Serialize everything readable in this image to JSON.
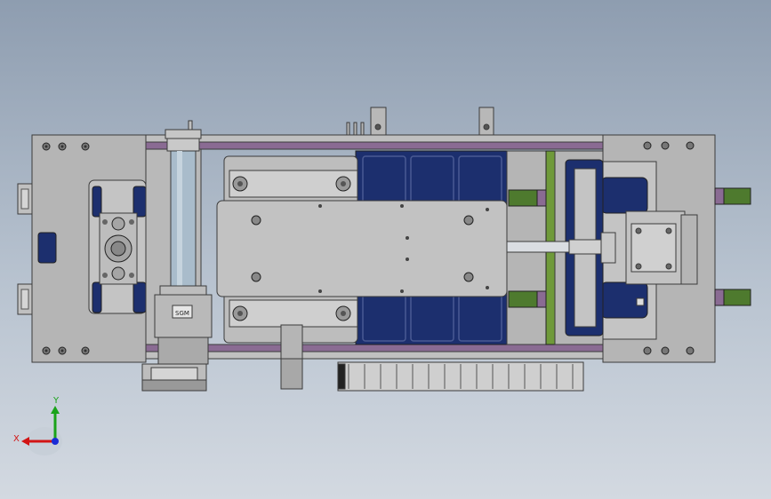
{
  "view": {
    "colors": {
      "bg_top": "#8e9db0",
      "bg_bottom": "#d3d9e1",
      "steel": "#b3b3b3",
      "steel_light": "#c9c9c9",
      "steel_dark": "#8f8f8f",
      "navy": "#1c2f6e",
      "purple_rail": "#8a6b93",
      "green_rail": "#6f9a3a",
      "green_block": "#4e7a2e",
      "cylinder": "#a9bccb",
      "edge": "#3b3b3b"
    }
  },
  "model": {
    "parts": [
      "left-end-plate",
      "right-end-plate",
      "top-rail",
      "bottom-rail",
      "navy-bed",
      "carriage-plate",
      "motor-cylinder",
      "gear-motor",
      "ball-screw",
      "nut-block",
      "cable-chain",
      "guide-blocks"
    ],
    "motor_label": "SGM"
  },
  "triad": {
    "x_label": "X",
    "y_label": "Y",
    "x_color": "#d21414",
    "y_color": "#1aa31a",
    "z_color": "#1a2bd6"
  }
}
